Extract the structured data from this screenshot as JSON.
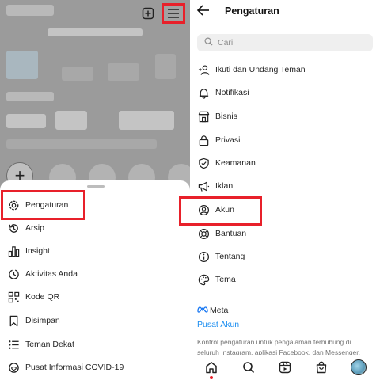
{
  "left_panel": {
    "sheet": {
      "items": [
        {
          "label": "Pengaturan",
          "icon": "settings-gear-icon"
        },
        {
          "label": "Arsip",
          "icon": "archive-history-icon"
        },
        {
          "label": "Insight",
          "icon": "insights-bar-icon"
        },
        {
          "label": "Aktivitas Anda",
          "icon": "activity-clock-icon"
        },
        {
          "label": "Kode QR",
          "icon": "qr-code-icon"
        },
        {
          "label": "Disimpan",
          "icon": "bookmark-icon"
        },
        {
          "label": "Teman Dekat",
          "icon": "close-friends-list-icon"
        },
        {
          "label": "Pusat Informasi COVID-19",
          "icon": "covid-info-icon"
        }
      ]
    },
    "top_icons": [
      "new-post-icon",
      "hamburger-menu-icon"
    ]
  },
  "right_panel": {
    "header": {
      "title": "Pengaturan"
    },
    "search": {
      "placeholder": "Cari"
    },
    "items": [
      {
        "label": "Ikuti dan Undang Teman",
        "icon": "add-person-icon"
      },
      {
        "label": "Notifikasi",
        "icon": "bell-icon"
      },
      {
        "label": "Bisnis",
        "icon": "store-icon"
      },
      {
        "label": "Privasi",
        "icon": "lock-icon"
      },
      {
        "label": "Keamanan",
        "icon": "shield-icon"
      },
      {
        "label": "Iklan",
        "icon": "megaphone-icon"
      },
      {
        "label": "Akun",
        "icon": "account-circle-icon"
      },
      {
        "label": "Bantuan",
        "icon": "lifebuoy-icon"
      },
      {
        "label": "Tentang",
        "icon": "info-icon"
      },
      {
        "label": "Tema",
        "icon": "palette-icon"
      }
    ],
    "meta": {
      "brand": "Meta",
      "link": "Pusat Akun",
      "description": "Kontrol pengaturan untuk pengalaman terhubung di seluruh Instagram, aplikasi Facebook, dan Messenger,"
    },
    "bottom_nav": [
      "home-icon",
      "search-icon",
      "reels-icon",
      "shop-icon",
      "profile-avatar"
    ]
  },
  "colors": {
    "highlight": "#e8202a",
    "link": "#1c8ef0",
    "overlay": "#9b9b9b"
  }
}
